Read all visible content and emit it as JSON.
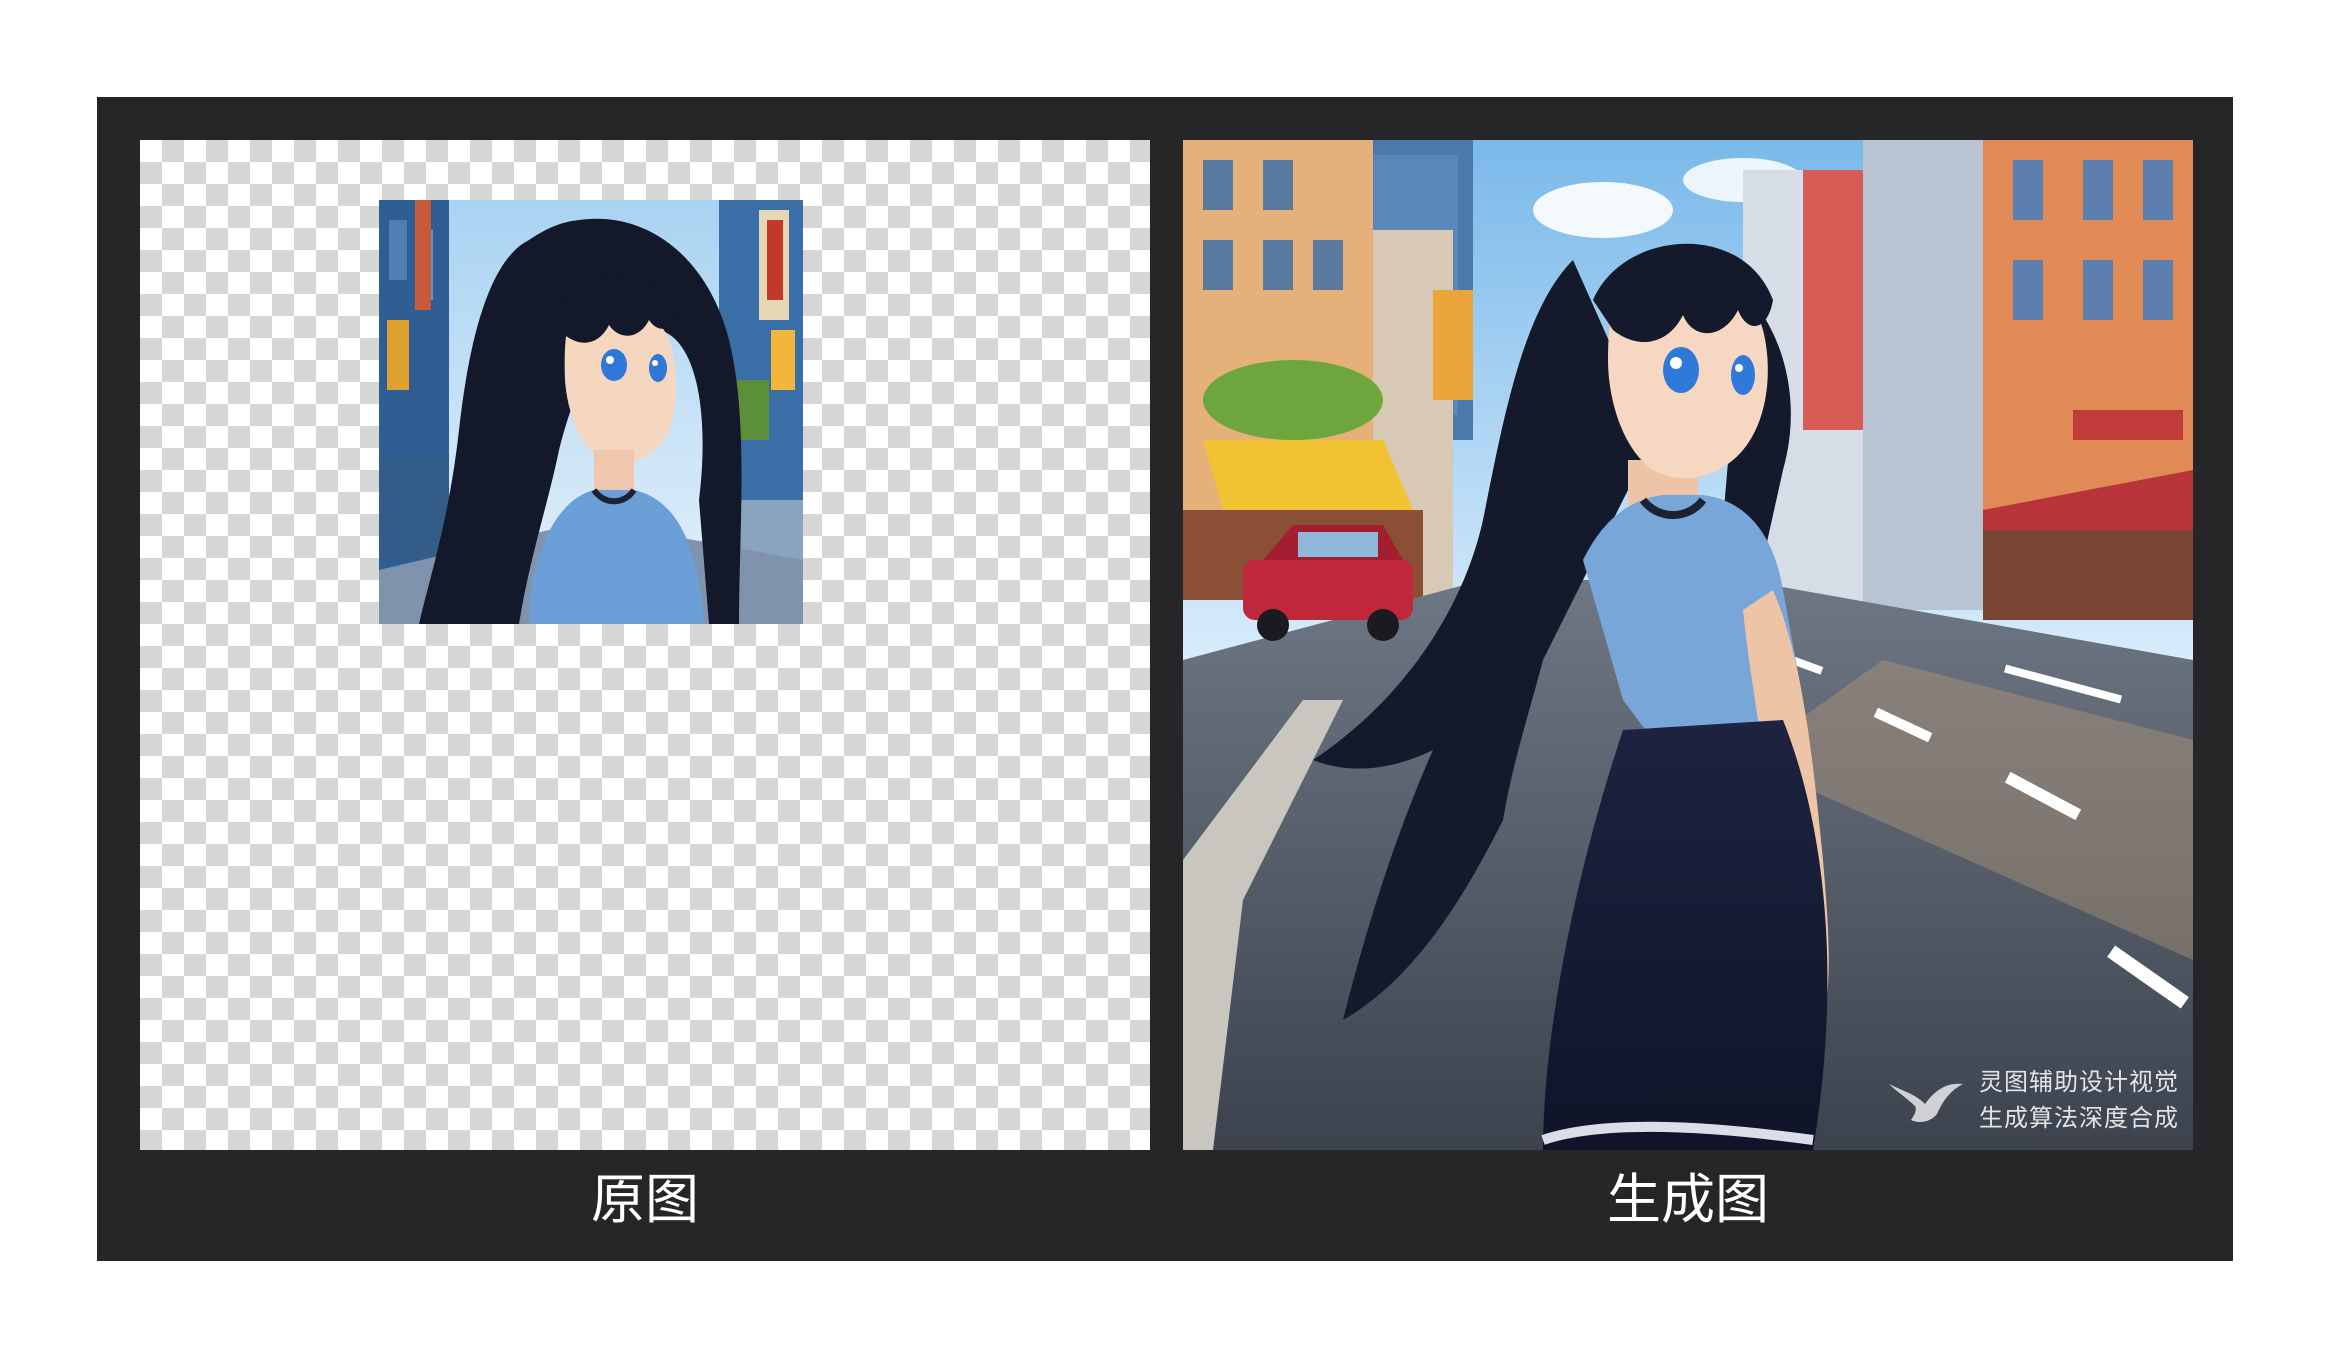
{
  "captions": {
    "original": "原图",
    "generated": "生成图"
  },
  "watermark": {
    "line1": "灵图辅助设计视觉",
    "line2": "生成算法深度合成",
    "icon": "bird-logo-icon"
  },
  "colors": {
    "frame_background": "#262628",
    "page_background": "#ffffff",
    "caption_text": "#ffffff"
  }
}
